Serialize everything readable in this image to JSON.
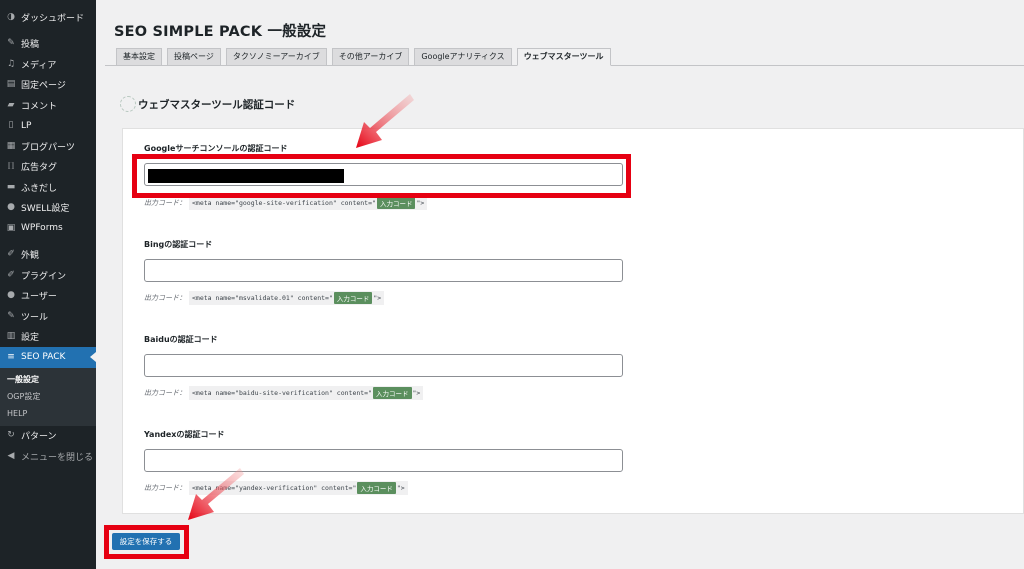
{
  "sidebar": {
    "items": [
      {
        "label": "ダッシュボード",
        "icon": "dashboard-icon",
        "glyph": "◑"
      },
      {
        "label": "投稿",
        "icon": "pin-icon",
        "glyph": "✎"
      },
      {
        "label": "メディア",
        "icon": "media-icon",
        "glyph": "♫"
      },
      {
        "label": "固定ページ",
        "icon": "page-icon",
        "glyph": "▤"
      },
      {
        "label": "コメント",
        "icon": "comment-icon",
        "glyph": "▰"
      },
      {
        "label": "LP",
        "icon": "lp-icon",
        "glyph": "▯"
      },
      {
        "label": "ブログパーツ",
        "icon": "blog-parts-icon",
        "glyph": "▦"
      },
      {
        "label": "広告タグ",
        "icon": "ad-tag-icon",
        "glyph": "⟦⟧"
      },
      {
        "label": "ふきだし",
        "icon": "balloon-icon",
        "glyph": "▬"
      },
      {
        "label": "SWELL設定",
        "icon": "swell-icon",
        "glyph": "●"
      },
      {
        "label": "WPForms",
        "icon": "wpforms-icon",
        "glyph": "▣"
      },
      {
        "label": "外観",
        "icon": "appearance-icon",
        "glyph": "✐"
      },
      {
        "label": "プラグイン",
        "icon": "plugin-icon",
        "glyph": "✐"
      },
      {
        "label": "ユーザー",
        "icon": "user-icon",
        "glyph": "●"
      },
      {
        "label": "ツール",
        "icon": "tool-icon",
        "glyph": "✎"
      },
      {
        "label": "設定",
        "icon": "settings-icon",
        "glyph": "▥"
      },
      {
        "label": "SEO PACK",
        "icon": "seo-pack-icon",
        "glyph": "≡"
      }
    ],
    "submenu": [
      "一般設定",
      "OGP設定",
      "HELP"
    ],
    "bottom": [
      {
        "label": "パターン",
        "icon": "pattern-icon",
        "glyph": "↻"
      },
      {
        "label": "メニューを閉じる",
        "icon": "collapse-icon",
        "glyph": "◀"
      }
    ]
  },
  "page": {
    "title": "SEO SIMPLE PACK 一般設定"
  },
  "tabs": [
    "基本設定",
    "投稿ページ",
    "タクソノミーアーカイブ",
    "その他アーカイブ",
    "Googleアナリティクス",
    "ウェブマスターツール"
  ],
  "section": {
    "title": "ウェブマスターツール認証コード"
  },
  "fields": {
    "google": {
      "label": "Googleサーチコンソールの認証コード",
      "hint_prefix": "出力コード：",
      "code_before": "<meta name=\"google-site-verification\" content=\"",
      "tag": "入力コード",
      "code_after": "\">"
    },
    "bing": {
      "label": "Bingの認証コード",
      "hint_prefix": "出力コード：",
      "code_before": "<meta name=\"msvalidate.01\" content=\"",
      "tag": "入力コード",
      "code_after": "\">"
    },
    "baidu": {
      "label": "Baiduの認証コード",
      "hint_prefix": "出力コード：",
      "code_before": "<meta name=\"baidu-site-verification\" content=\"",
      "tag": "入力コード",
      "code_after": "\">"
    },
    "yandex": {
      "label": "Yandexの認証コード",
      "hint_prefix": "出力コード：",
      "code_before": "<meta name=\"yandex-verification\" content=\"",
      "tag": "入力コード",
      "code_after": "\">"
    }
  },
  "actions": {
    "save_label": "設定を保存する"
  },
  "colors": {
    "highlight": "#e60012",
    "primary": "#2271b1",
    "sidebar": "#1d2327"
  }
}
